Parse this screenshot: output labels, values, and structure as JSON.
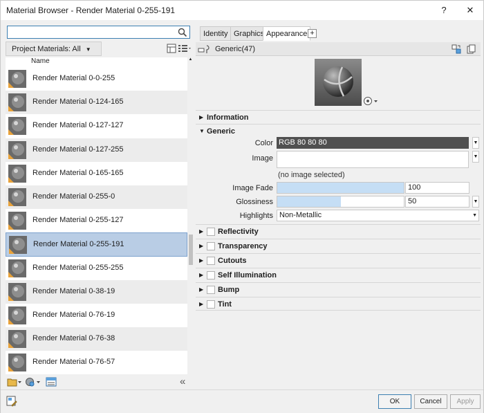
{
  "window": {
    "title": "Material Browser - Render Material 0-255-191",
    "help": "?",
    "close": "✕"
  },
  "left": {
    "search_placeholder": "",
    "project_dropdown": "Project Materials: All",
    "column_header": "Name",
    "items": [
      "Render Material 0-0-255",
      "Render Material 0-124-165",
      "Render Material 0-127-127",
      "Render Material 0-127-255",
      "Render Material 0-165-165",
      "Render Material 0-255-0",
      "Render Material 0-255-127",
      "Render Material 0-255-191",
      "Render Material 0-255-255",
      "Render Material 0-38-19",
      "Render Material 0-76-19",
      "Render Material 0-76-38",
      "Render Material 0-76-57"
    ],
    "selected_index": 7,
    "collapse_label": "«"
  },
  "right": {
    "tabs": [
      "Identity",
      "Graphics",
      "Appearance"
    ],
    "active_tab": "Appearance",
    "add_tab": "+",
    "asset_name": "Generic(47)",
    "sections": {
      "information": "Information",
      "generic": "Generic",
      "reflectivity": "Reflectivity",
      "transparency": "Transparency",
      "cutouts": "Cutouts",
      "self_illumination": "Self Illumination",
      "bump": "Bump",
      "tint": "Tint"
    },
    "props": {
      "color_label": "Color",
      "color_value": "RGB 80 80 80",
      "image_label": "Image",
      "no_image": "(no image selected)",
      "image_fade_label": "Image Fade",
      "image_fade_value": "100",
      "image_fade_fill": 1.0,
      "glossiness_label": "Glossiness",
      "glossiness_value": "50",
      "glossiness_fill": 0.5,
      "highlights_label": "Highlights",
      "highlights_value": "Non-Metallic"
    }
  },
  "footer": {
    "ok": "OK",
    "cancel": "Cancel",
    "apply": "Apply"
  }
}
